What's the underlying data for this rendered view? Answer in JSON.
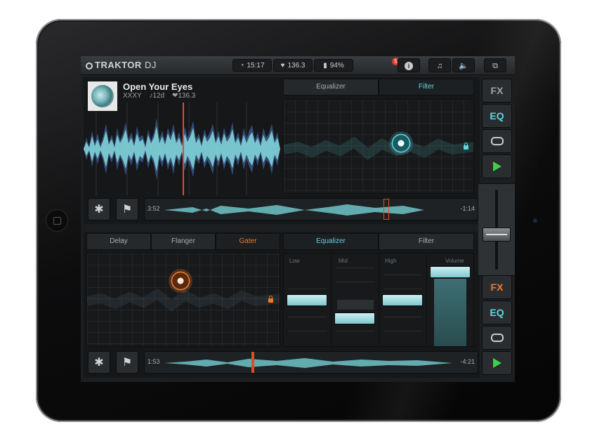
{
  "app": {
    "brand": "TRAKTOR",
    "product": "DJ"
  },
  "topbar": {
    "time": "15:17",
    "bpm": "136.3",
    "battery": "94%",
    "notification_count": "5",
    "info_label": "i",
    "music_icon": "♫",
    "speaker_icon": "🔈",
    "layout_icon": "⧉"
  },
  "deck_a": {
    "track_title": "Open Your Eyes",
    "artist": "XXXY",
    "key": "♪12d",
    "bpm": "❤136.3",
    "elapsed": "3:52",
    "remaining": "-1:14",
    "fx_tabs": [
      {
        "label": "Equalizer",
        "active": false
      },
      {
        "label": "Filter",
        "active": true
      }
    ],
    "settings_icon": "✱",
    "flag_icon": "⚑"
  },
  "deck_b": {
    "elapsed": "1:53",
    "remaining": "-4:21",
    "fx_tabs": [
      {
        "label": "Delay",
        "active": false
      },
      {
        "label": "Flanger",
        "active": false
      },
      {
        "label": "Gater",
        "active": true
      }
    ],
    "eq_tabs": [
      {
        "label": "Equalizer",
        "active": true
      },
      {
        "label": "Filter",
        "active": false
      }
    ],
    "eq_bands": [
      {
        "label": "Low",
        "level": 0.55
      },
      {
        "label": "Mid",
        "level": 0.3
      },
      {
        "label": "High",
        "level": 0.55
      },
      {
        "label": "Volume",
        "level": 0.85
      }
    ],
    "settings_icon": "✱",
    "flag_icon": "⚑"
  },
  "side_a": {
    "fx": "FX",
    "eq": "EQ"
  },
  "side_b": {
    "fx": "FX",
    "eq": "EQ"
  },
  "colors": {
    "accent_cyan": "#5fd6e0",
    "accent_orange": "#f07a2a",
    "play_green": "#3bd24a",
    "cue_red": "#e04a2c"
  }
}
